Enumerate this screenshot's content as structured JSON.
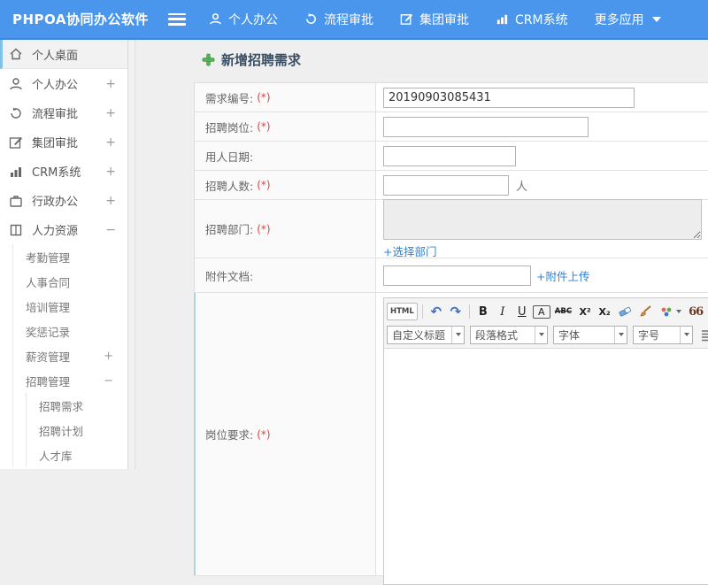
{
  "colors": {
    "topbar_blue": "#4a96ec",
    "link_blue": "#2f81d8",
    "required_red": "#e04343",
    "active_item_border": "#7fc4e8",
    "title_plus_green": "#54b554"
  },
  "topbar": {
    "logo": "PHPOA协同办公软件",
    "nav": [
      {
        "label": "个人办公",
        "icon": "user-icon"
      },
      {
        "label": "流程审批",
        "icon": "history-icon"
      },
      {
        "label": "集团审批",
        "icon": "edit-icon"
      },
      {
        "label": "CRM系统",
        "icon": "chart-icon"
      },
      {
        "label": "更多应用",
        "icon": "caret-down-icon"
      }
    ]
  },
  "sidebar": {
    "items": [
      {
        "label": "个人桌面",
        "icon": "home-icon",
        "active": true
      },
      {
        "label": "个人办公",
        "icon": "user-icon",
        "expander": "+"
      },
      {
        "label": "流程审批",
        "icon": "history-icon",
        "expander": "+"
      },
      {
        "label": "集团审批",
        "icon": "edit-icon",
        "expander": "+"
      },
      {
        "label": "CRM系统",
        "icon": "chart-icon",
        "expander": "+"
      },
      {
        "label": "行政办公",
        "icon": "briefcase-icon",
        "expander": "+"
      },
      {
        "label": "人力资源",
        "icon": "book-icon",
        "expander": "−"
      }
    ],
    "hr_children": [
      {
        "label": "考勤管理"
      },
      {
        "label": "人事合同"
      },
      {
        "label": "培训管理"
      },
      {
        "label": "奖惩记录"
      },
      {
        "label": "薪资管理",
        "expander": "+"
      },
      {
        "label": "招聘管理",
        "expander": "−"
      }
    ],
    "recruit_children": [
      {
        "label": "招聘需求"
      },
      {
        "label": "招聘计划"
      },
      {
        "label": "人才库"
      }
    ]
  },
  "main": {
    "title": "新增招聘需求",
    "form": {
      "rows": [
        {
          "label": "需求编号:",
          "required": "(*)",
          "value": "20190903085431"
        },
        {
          "label": "招聘岗位:",
          "required": "(*)",
          "value": ""
        },
        {
          "label": "用人日期:",
          "required": "",
          "value": ""
        },
        {
          "label": "招聘人数:",
          "required": "(*)",
          "value": "",
          "suffix": "人"
        },
        {
          "label": "招聘部门:",
          "required": "(*)",
          "value": "",
          "action_link": "+选择部门"
        },
        {
          "label": "附件文档:",
          "required": "",
          "value": "",
          "action_link": "+附件上传"
        },
        {
          "label": "岗位要求:",
          "required": "(*)"
        }
      ]
    },
    "editor": {
      "toolbar": {
        "source_label": "HTML",
        "undo_glyph": "↶",
        "redo_glyph": "↷",
        "bold_label": "B",
        "italic_label": "I",
        "underline_label": "U",
        "fontbox_label": "A",
        "strike_label": "ABC",
        "superscript_label": "X²",
        "subscript_label": "X₂",
        "quote_label": "66",
        "fontcolor_label": "A",
        "selects": [
          {
            "label": "自定义标题"
          },
          {
            "label": "段落格式"
          },
          {
            "label": "字体"
          },
          {
            "label": "字号"
          }
        ]
      }
    }
  }
}
